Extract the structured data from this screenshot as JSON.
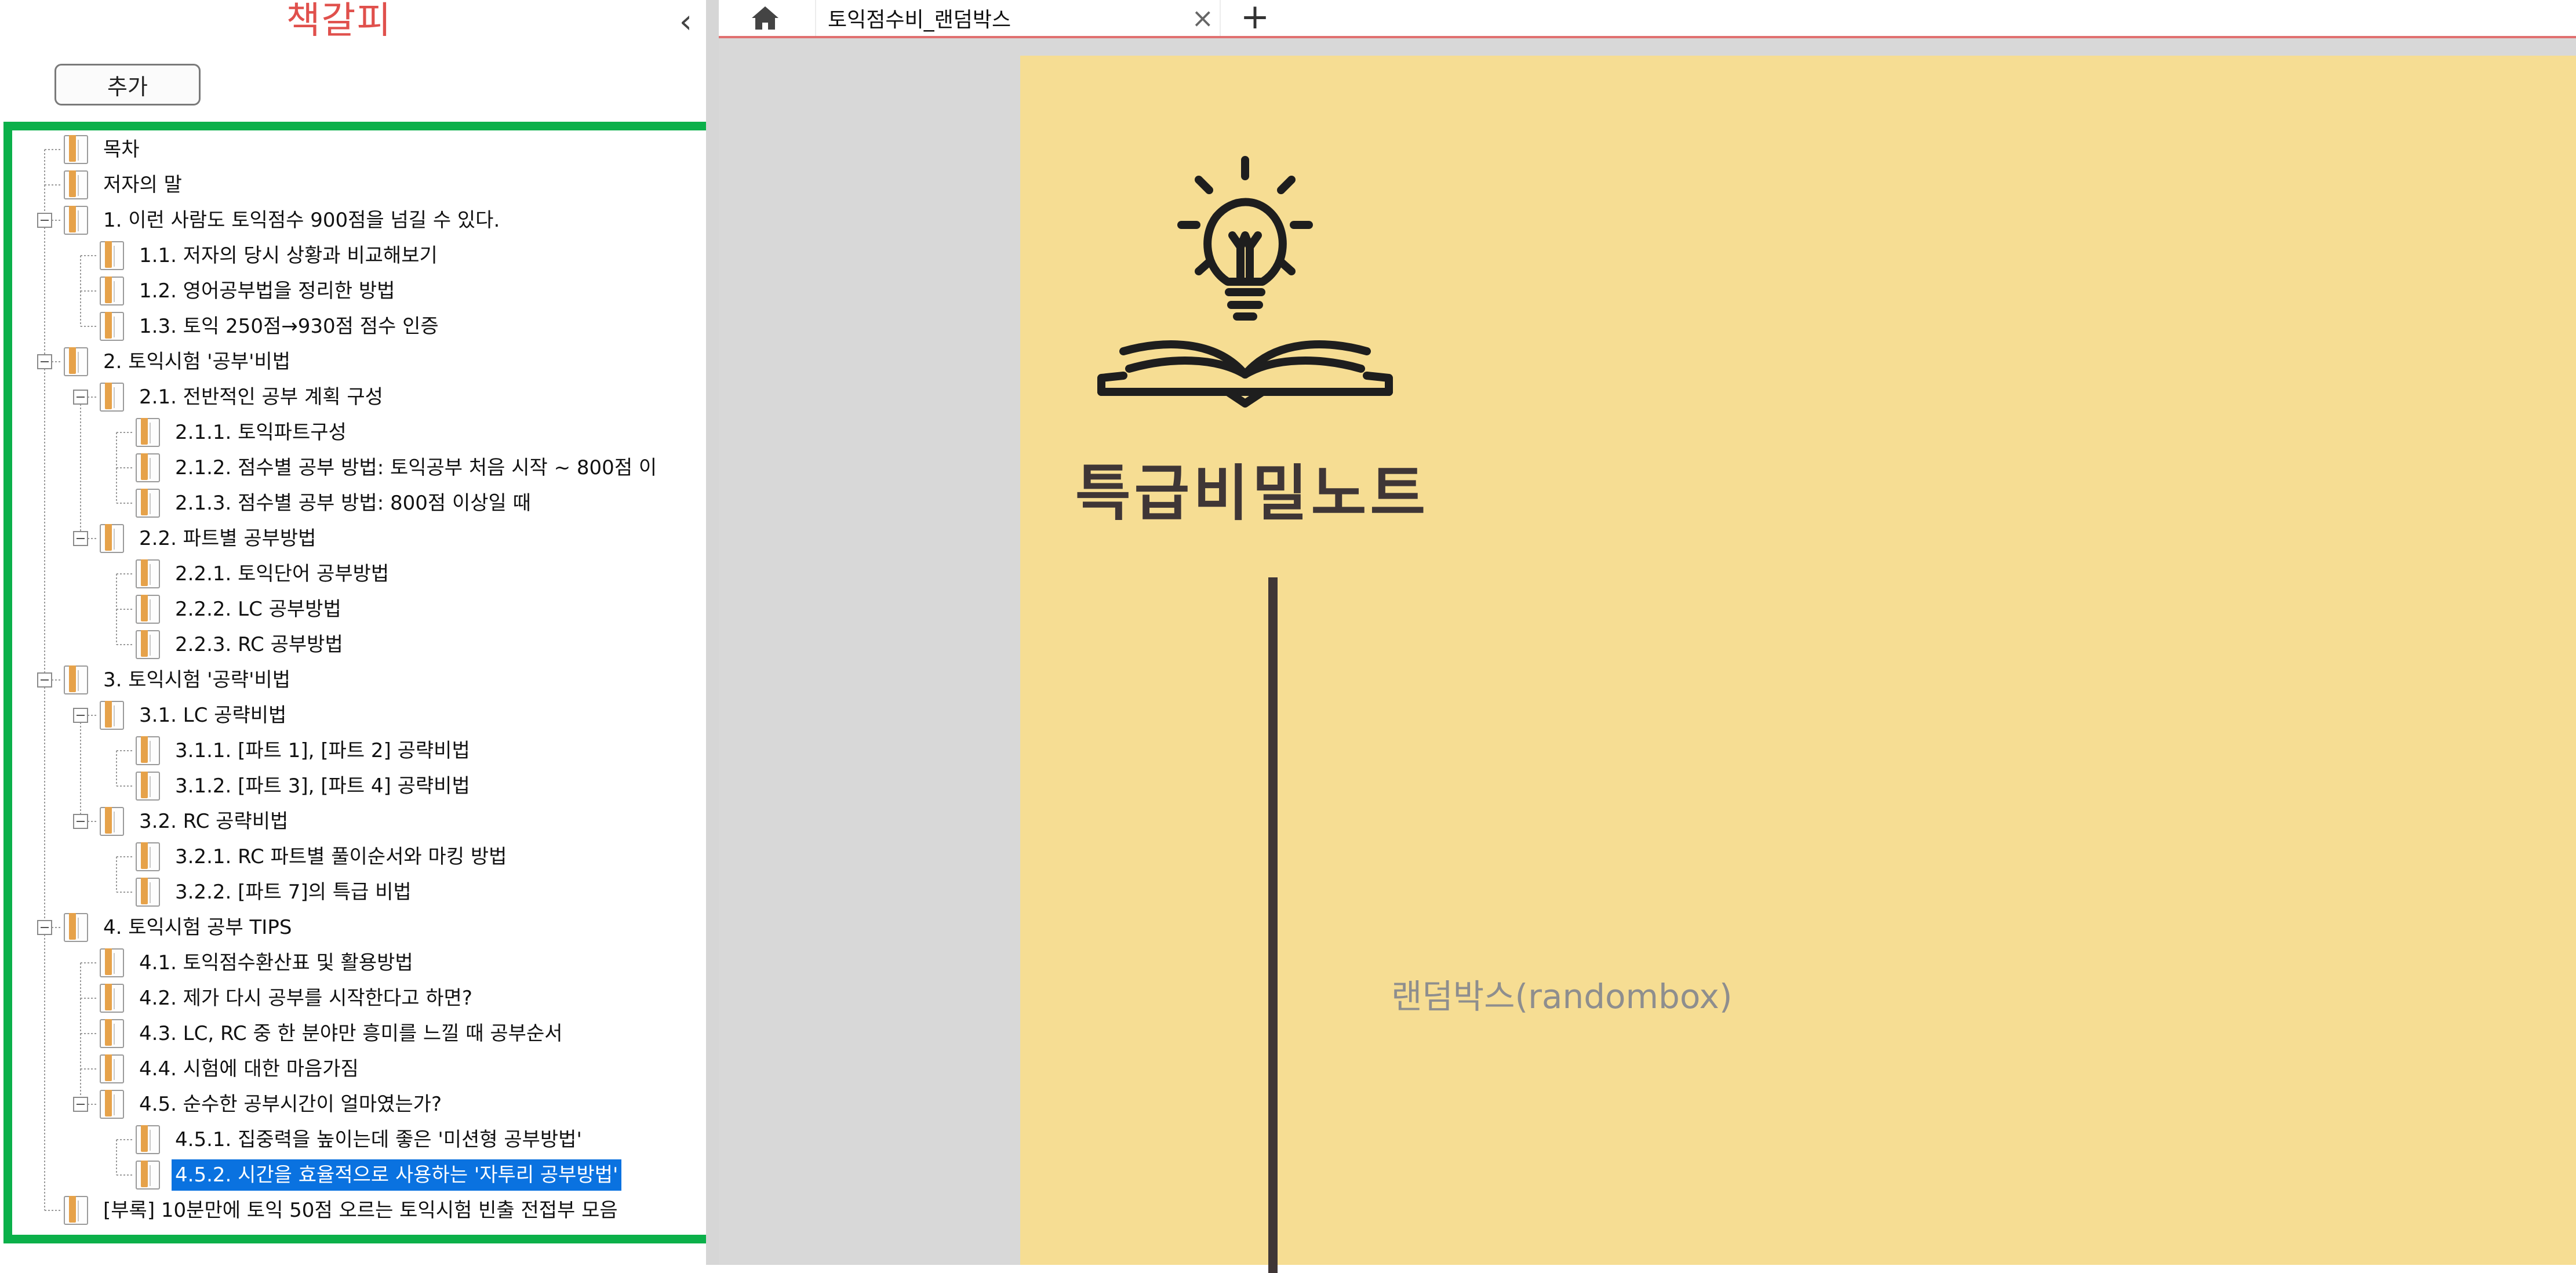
{
  "sidebar": {
    "title": "책갈피",
    "collapse_icon": "chevron-left-icon",
    "add_label": "추가",
    "tree": [
      {
        "label": "목차",
        "level": 0,
        "toggle": false
      },
      {
        "label": "저자의 말",
        "level": 0,
        "toggle": false
      },
      {
        "label": "1. 이런 사람도 토익점수 900점을 넘길 수 있다.",
        "level": 0,
        "toggle": true
      },
      {
        "label": "1.1. 저자의 당시 상황과 비교해보기",
        "level": 1,
        "toggle": false
      },
      {
        "label": "1.2. 영어공부법을 정리한 방법",
        "level": 1,
        "toggle": false
      },
      {
        "label": "1.3. 토익 250점→930점 점수 인증",
        "level": 1,
        "toggle": false
      },
      {
        "label": "2. 토익시험 '공부'비법",
        "level": 0,
        "toggle": true
      },
      {
        "label": "2.1. 전반적인 공부 계획 구성",
        "level": 1,
        "toggle": true
      },
      {
        "label": "2.1.1. 토익파트구성",
        "level": 2,
        "toggle": false
      },
      {
        "label": "2.1.2. 점수별 공부 방법: 토익공부 처음 시작 ~ 800점 이",
        "level": 2,
        "toggle": false
      },
      {
        "label": "2.1.3. 점수별 공부 방법: 800점 이상일 때",
        "level": 2,
        "toggle": false
      },
      {
        "label": "2.2. 파트별 공부방법",
        "level": 1,
        "toggle": true
      },
      {
        "label": "2.2.1. 토익단어 공부방법",
        "level": 2,
        "toggle": false
      },
      {
        "label": "2.2.2. LC 공부방법",
        "level": 2,
        "toggle": false
      },
      {
        "label": "2.2.3. RC 공부방법",
        "level": 2,
        "toggle": false
      },
      {
        "label": "3. 토익시험 '공략'비법",
        "level": 0,
        "toggle": true
      },
      {
        "label": "3.1. LC 공략비법",
        "level": 1,
        "toggle": true
      },
      {
        "label": "3.1.1. [파트 1], [파트 2] 공략비법",
        "level": 2,
        "toggle": false
      },
      {
        "label": "3.1.2. [파트 3], [파트 4] 공략비법",
        "level": 2,
        "toggle": false
      },
      {
        "label": "3.2. RC 공략비법",
        "level": 1,
        "toggle": true
      },
      {
        "label": "3.2.1. RC 파트별 풀이순서와 마킹 방법",
        "level": 2,
        "toggle": false
      },
      {
        "label": "3.2.2. [파트 7]의 특급 비법",
        "level": 2,
        "toggle": false
      },
      {
        "label": "4. 토익시험 공부 TIPS",
        "level": 0,
        "toggle": true
      },
      {
        "label": "4.1. 토익점수환산표 및 활용방법",
        "level": 1,
        "toggle": false
      },
      {
        "label": "4.2. 제가 다시 공부를 시작한다고 하면?",
        "level": 1,
        "toggle": false
      },
      {
        "label": "4.3. LC, RC 중 한 분야만 흥미를 느낄 때 공부순서",
        "level": 1,
        "toggle": false
      },
      {
        "label": "4.4. 시험에 대한 마음가짐",
        "level": 1,
        "toggle": false
      },
      {
        "label": "4.5. 순수한 공부시간이 얼마였는가?",
        "level": 1,
        "toggle": true
      },
      {
        "label": "4.5.1. 집중력을 높이는데 좋은 '미션형 공부방법'",
        "level": 2,
        "toggle": false
      },
      {
        "label": "4.5.2. 시간을 효율적으로 사용하는 '자투리 공부방법'",
        "level": 2,
        "toggle": false,
        "selected": true
      },
      {
        "label": "[부록] 10분만에 토익 50점 오르는 토익시험 빈출 전접부 모음",
        "level": 0,
        "toggle": false
      }
    ],
    "bookmark_icon": "bookmark-page-icon",
    "highlight_color": "#0bb04a",
    "selection_color": "#0a72e0"
  },
  "tabs": {
    "home_icon": "home-icon",
    "active_tab_label": "토익점수비_랜덤박스",
    "close_icon": "close-icon",
    "new_tab_label": "+"
  },
  "document": {
    "logo_icon": "lightbulb-book-icon",
    "heading": "특급비밀노트",
    "caption": "랜덤박스(randombox)",
    "page_color": "#f6dd93"
  }
}
